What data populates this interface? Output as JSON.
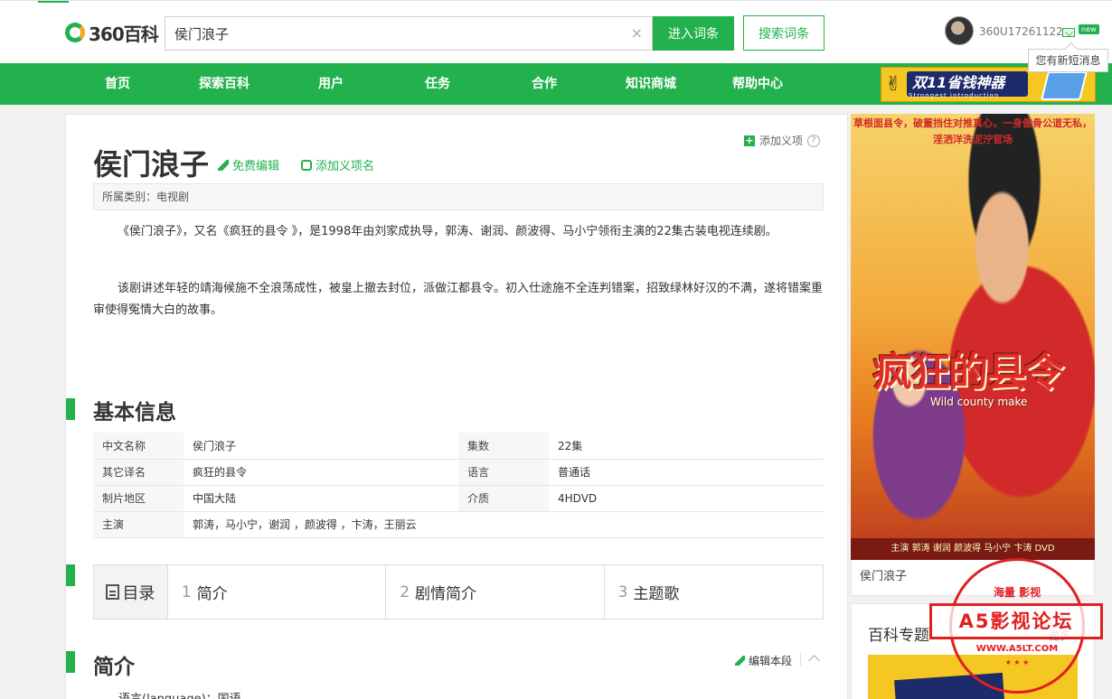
{
  "header": {
    "logo_text": "360百科",
    "search_value": "侯门浪子",
    "clear_glyph": "×",
    "enter_button": "进入词条",
    "search_button": "搜索词条",
    "username": "360U17261122",
    "new_badge": "new",
    "message_tip": "您有新短消息"
  },
  "nav": {
    "items": [
      "首页",
      "探索百科",
      "用户",
      "任务",
      "合作",
      "知识商城",
      "帮助中心"
    ],
    "promo_title": "双11省钱神器",
    "promo_sub": "Strongest introduction"
  },
  "article": {
    "add_sense": "添加义项",
    "help_glyph": "?",
    "title": "侯门浪子",
    "edit_link": "免费编辑",
    "add_name_link": "添加义项名",
    "category": "所属类别：电视剧",
    "paragraphs": [
      "《侯门浪子》，又名《疯狂的县令 》，是1998年由刘家成执导，郭涛、谢润、颜波得、马小宁领衔主演的22集古装电视连续剧。",
      "该剧讲述年轻的靖海候施不全浪荡成性，被皇上撤去封位，派做江都县令。初入仕途施不全连判错案，招致绿林好汉的不满，遂将错案重审使得冤情大白的故事。"
    ],
    "basic_info_title": "基本信息",
    "basic_info": [
      {
        "k1": "中文名称",
        "v1": "侯门浪子",
        "k2": "集数",
        "v2": "22集"
      },
      {
        "k1": "其它译名",
        "v1": "疯狂的县令",
        "k2": "语言",
        "v2": "普通话"
      },
      {
        "k1": "制片地区",
        "v1": "中国大陆",
        "k2": "介质",
        "v2": "4HDVD"
      },
      {
        "k1": "主演",
        "v1": "郭涛，马小宁，谢润 ，颜波得 ，卞涛，王丽云"
      }
    ],
    "toc": {
      "head": "目录",
      "items": [
        {
          "num": "1",
          "label": "简介"
        },
        {
          "num": "2",
          "label": "剧情简介"
        },
        {
          "num": "3",
          "label": "主题歌"
        }
      ]
    },
    "intro_title": "简介",
    "edit_section": "编辑本段",
    "language_line": "语言(language)：国语"
  },
  "sidebar": {
    "poster_top_text": "草根面县令，破董挡住对推真心，一身傲骨公道无私，淫洒洋洗泥泞官场",
    "poster_title": "疯狂的县令",
    "poster_sub": "Wild county make",
    "poster_bottom": "主演 郭涛 谢润 颜波得 马小宁 卞涛 DVD",
    "caption": "侯门浪子",
    "topic_title": "百科专题",
    "more": "更多"
  },
  "watermark": {
    "top": "海量 影视",
    "star": "★",
    "band": "A5影视论坛",
    "url": "WWW.A5LT.COM",
    "dots": "★ ★ ★"
  }
}
